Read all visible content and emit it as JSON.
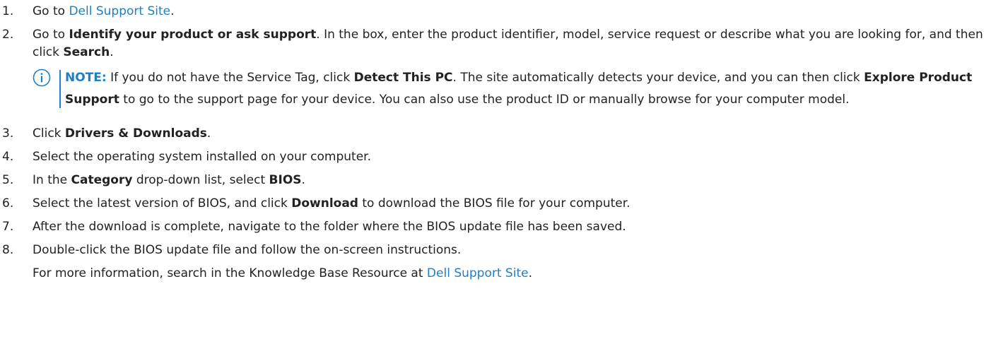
{
  "steps": [
    {
      "num": "1",
      "pre": "Go to ",
      "link": "Dell Support Site",
      "post": "."
    },
    {
      "num": "2",
      "pre": "Go to ",
      "bold1": "Identify your product or ask support",
      "mid": ". In the box, enter the product identifier, model, service request or describe what you are looking for, and then click ",
      "bold2": "Search",
      "post": "."
    },
    {
      "num": "3",
      "pre": "Click ",
      "bold1": "Drivers & Downloads",
      "post": "."
    },
    {
      "num": "4",
      "text": "Select the operating system installed on your computer."
    },
    {
      "num": "5",
      "pre": "In the ",
      "bold1": "Category",
      "mid": " drop-down list, select ",
      "bold2": "BIOS",
      "post": "."
    },
    {
      "num": "6",
      "pre": "Select the latest version of BIOS, and click ",
      "bold1": "Download",
      "post": " to download the BIOS file for your computer."
    },
    {
      "num": "7",
      "text": "After the download is complete, navigate to the folder where the BIOS update file has been saved."
    },
    {
      "num": "8",
      "text": "Double-click the BIOS update file and follow the on-screen instructions."
    }
  ],
  "note": {
    "label": "NOTE:",
    "pre": " If you do not have the Service Tag, click ",
    "bold1": "Detect This PC",
    "mid": ". The site automatically detects your device, and you can then click ",
    "bold2": "Explore Product Support",
    "post": " to go to the support page for your device. You can also use the product ID or manually browse for your computer model.",
    "icon": "info-icon",
    "accent": "#1f7fc4"
  },
  "followup": {
    "pre": "For more information, search in the Knowledge Base Resource at ",
    "link": "Dell Support Site",
    "post": "."
  },
  "colors": {
    "text": "#222222",
    "link": "#1f7fc4"
  }
}
